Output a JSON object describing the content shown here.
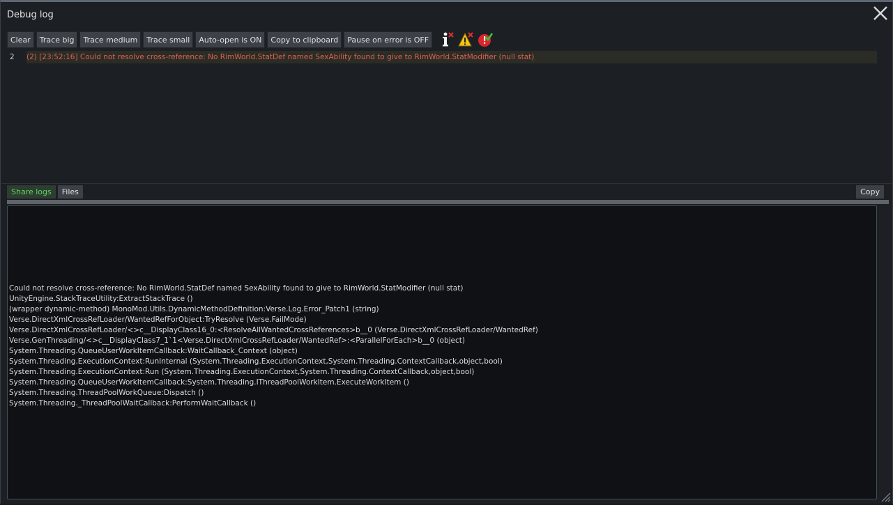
{
  "window": {
    "title": "Debug log"
  },
  "toolbar": {
    "buttons": [
      {
        "label": "Clear"
      },
      {
        "label": "Trace big"
      },
      {
        "label": "Trace medium"
      },
      {
        "label": "Trace small"
      },
      {
        "label": "Auto-open is ON"
      },
      {
        "label": "Copy to clipboard"
      },
      {
        "label": "Pause on error is OFF"
      }
    ],
    "icons": [
      "info-clear-icon",
      "warning-clear-icon",
      "error-check-icon"
    ]
  },
  "log": {
    "entries": [
      {
        "number": "2",
        "message": "(2) [23:52:16] Could not resolve cross-reference: No RimWorld.StatDef named SexAbility found to give to RimWorld.StatModifier (null stat)"
      }
    ]
  },
  "tabs": {
    "share_label": "Share logs",
    "files_label": "Files",
    "copy_label": "Copy"
  },
  "detail": {
    "lines": [
      "Could not resolve cross-reference: No RimWorld.StatDef named SexAbility found to give to RimWorld.StatModifier (null stat)",
      "UnityEngine.StackTraceUtility:ExtractStackTrace ()",
      "(wrapper dynamic-method) MonoMod.Utils.DynamicMethodDefinition:Verse.Log.Error_Patch1 (string)",
      "Verse.DirectXmlCrossRefLoader/WantedRefForObject:TryResolve (Verse.FailMode)",
      "Verse.DirectXmlCrossRefLoader/<>c__DisplayClass16_0:<ResolveAllWantedCrossReferences>b__0 (Verse.DirectXmlCrossRefLoader/WantedRef)",
      "Verse.GenThreading/<>c__DisplayClass7_1`1<Verse.DirectXmlCrossRefLoader/WantedRef>:<ParallelForEach>b__0 (object)",
      "System.Threading.QueueUserWorkItemCallback:WaitCallback_Context (object)",
      "System.Threading.ExecutionContext:RunInternal (System.Threading.ExecutionContext,System.Threading.ContextCallback,object,bool)",
      "System.Threading.ExecutionContext:Run (System.Threading.ExecutionContext,System.Threading.ContextCallback,object,bool)",
      "System.Threading.QueueUserWorkItemCallback:System.Threading.IThreadPoolWorkItem.ExecuteWorkItem ()",
      "System.Threading.ThreadPoolWorkQueue:Dispatch ()",
      "System.Threading._ThreadPoolWaitCallback:PerformWaitCallback ()"
    ]
  },
  "colors": {
    "error_text": "#d9614f",
    "share_tab_text": "#5bd85b",
    "warning_icon": "#f0c419",
    "error_icon": "#d8262b",
    "check_green": "#3ec43e"
  }
}
